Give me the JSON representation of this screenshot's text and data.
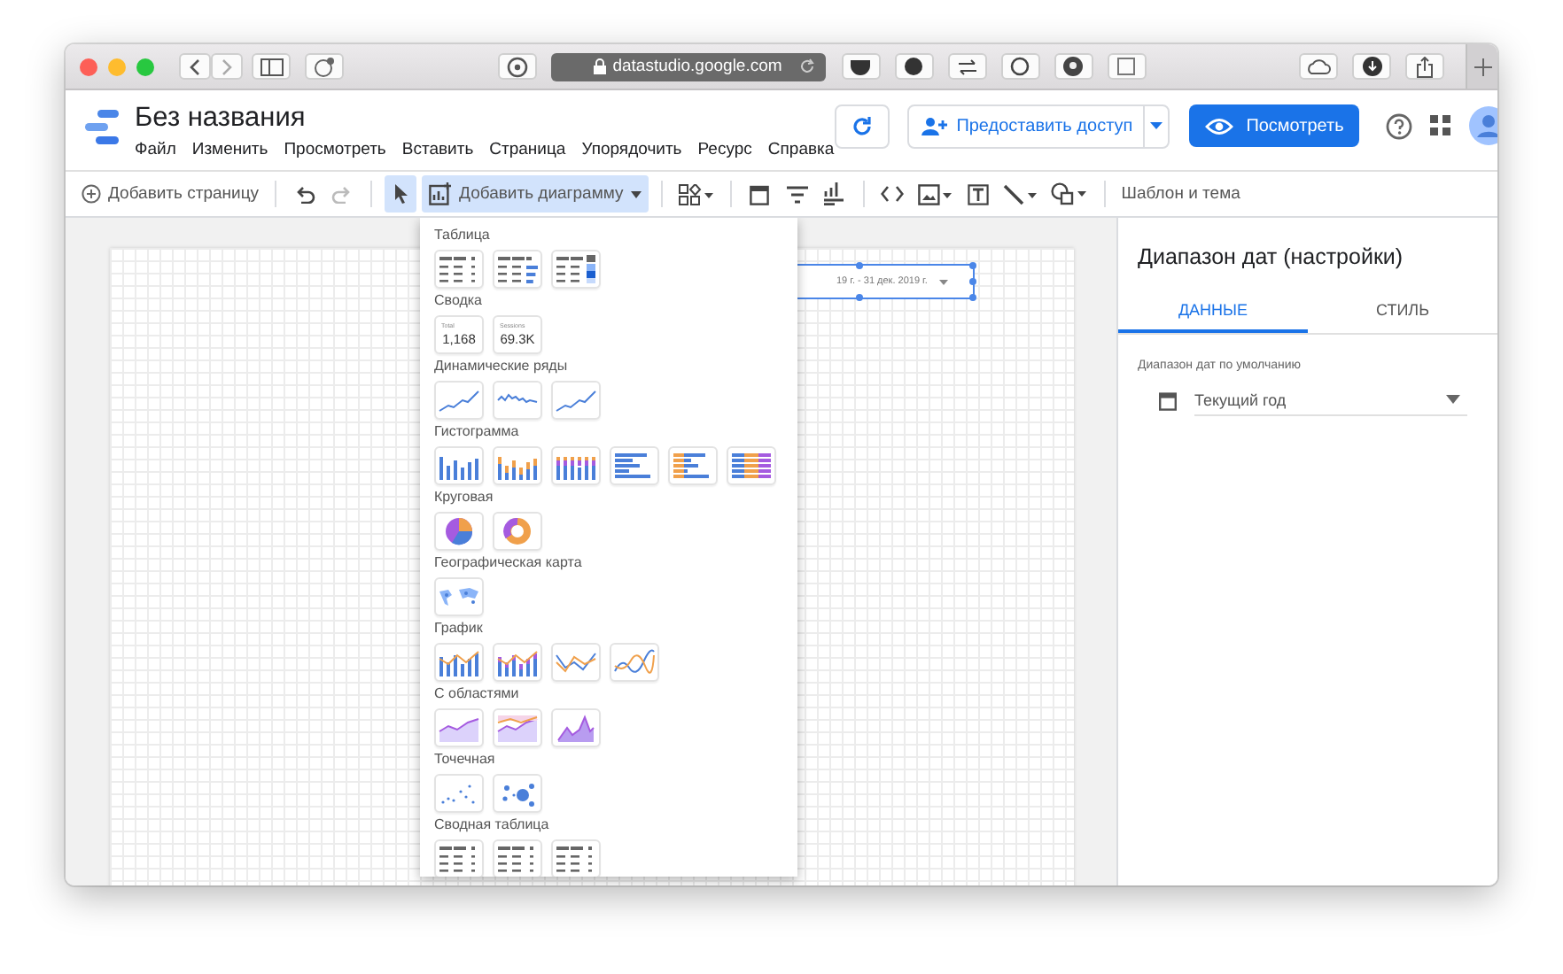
{
  "browser": {
    "url": "datastudio.google.com"
  },
  "app": {
    "title": "Без названия",
    "menu": [
      "Файл",
      "Изменить",
      "Просмотреть",
      "Вставить",
      "Страница",
      "Упорядочить",
      "Ресурс",
      "Справка"
    ],
    "share_label": "Предоставить доступ",
    "view_label": "Посмотреть"
  },
  "toolbar": {
    "add_page": "Добавить страницу",
    "pointer": {
      "selected": true
    },
    "add_chart": {
      "label": "Добавить диаграмму",
      "selected": true
    },
    "theme": "Шаблон и тема"
  },
  "canvas": {
    "date_control": {
      "text": "19 г. - 31 дек. 2019 г.",
      "selected": true
    }
  },
  "chart_menu": {
    "sections": [
      {
        "title": "Таблица",
        "items": [
          {
            "kind": "table"
          },
          {
            "kind": "table-bars"
          },
          {
            "kind": "table-heatmap"
          }
        ]
      },
      {
        "title": "Сводка",
        "items": [
          {
            "kind": "scorecard",
            "label": "Total",
            "value": "1,168"
          },
          {
            "kind": "scorecard",
            "label": "Sessions",
            "value": "69.3K"
          }
        ]
      },
      {
        "title": "Динамические ряды",
        "items": [
          {
            "kind": "line"
          },
          {
            "kind": "sparkline"
          },
          {
            "kind": "line"
          }
        ]
      },
      {
        "title": "Гистограмма",
        "items": [
          {
            "kind": "column"
          },
          {
            "kind": "column-grouped"
          },
          {
            "kind": "column-stacked"
          },
          {
            "kind": "bar"
          },
          {
            "kind": "bar-grouped"
          },
          {
            "kind": "bar-stacked"
          }
        ]
      },
      {
        "title": "Круговая",
        "items": [
          {
            "kind": "pie"
          },
          {
            "kind": "donut"
          }
        ]
      },
      {
        "title": "Географическая карта",
        "items": [
          {
            "kind": "geo"
          }
        ]
      },
      {
        "title": "График",
        "items": [
          {
            "kind": "combo"
          },
          {
            "kind": "combo-stacked"
          },
          {
            "kind": "two-lines"
          },
          {
            "kind": "two-lines-smooth"
          }
        ]
      },
      {
        "title": "С областями",
        "items": [
          {
            "kind": "area"
          },
          {
            "kind": "area-stacked"
          },
          {
            "kind": "area-peak"
          }
        ]
      },
      {
        "title": "Точечная",
        "items": [
          {
            "kind": "scatter"
          },
          {
            "kind": "bubble"
          }
        ]
      },
      {
        "title": "Сводная таблица",
        "items": [
          {
            "kind": "table"
          },
          {
            "kind": "table"
          },
          {
            "kind": "table"
          }
        ]
      }
    ]
  },
  "panel": {
    "title": "Диапазон дат (настройки)",
    "tabs": [
      {
        "label": "ДАННЫЕ",
        "selected": true
      },
      {
        "label": "СТИЛЬ",
        "selected": false
      }
    ],
    "field_label": "Диапазон дат по умолчанию",
    "field_value": "Текущий год"
  }
}
